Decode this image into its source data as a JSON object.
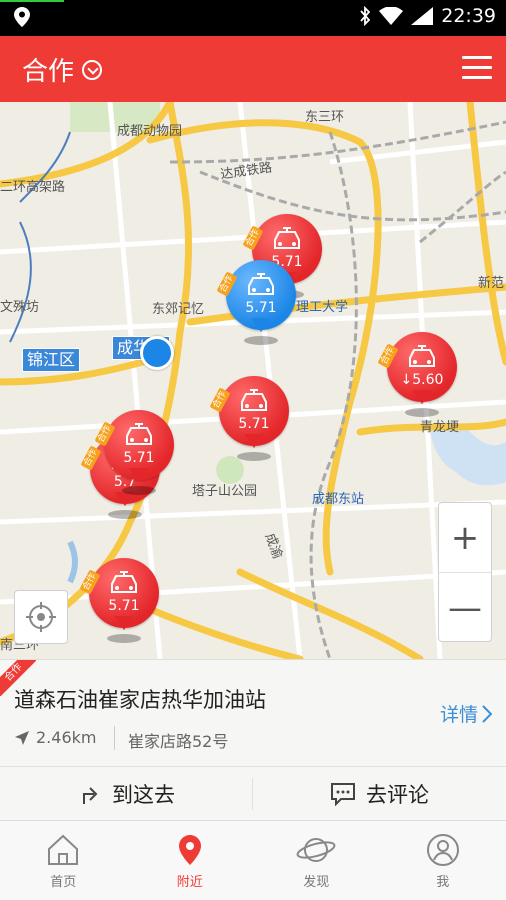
{
  "status_bar": {
    "time": "22:39"
  },
  "header": {
    "title": "合作"
  },
  "map": {
    "labels": [
      {
        "id": "zoo",
        "text": "成都动物园"
      },
      {
        "id": "dongsanhuan",
        "text": "东三环"
      },
      {
        "id": "dacheng",
        "text": "达成铁路"
      },
      {
        "id": "huangaojia",
        "text": "二环高架路"
      },
      {
        "id": "wenshufang",
        "text": "文殊坊"
      },
      {
        "id": "dongjiao",
        "text": "东郊记忆"
      },
      {
        "id": "ligong",
        "text": "理工大学"
      },
      {
        "id": "xinfan",
        "text": "新范"
      },
      {
        "id": "qinglong",
        "text": "青龙埂"
      },
      {
        "id": "tazishan",
        "text": "塔子山公园"
      },
      {
        "id": "dongzhan",
        "text": "成都东站"
      },
      {
        "id": "chengyu",
        "text": "成渝"
      },
      {
        "id": "nansan",
        "text": "南三环"
      }
    ],
    "districts": {
      "jinjiang": "锦江区",
      "chenghua": "成华区"
    },
    "pins": [
      {
        "id": "pin-top",
        "price": "5.71",
        "color": "red",
        "tag": "合作"
      },
      {
        "id": "pin-selected",
        "price": "5.71",
        "color": "blue",
        "tag": "合作"
      },
      {
        "id": "pin-right",
        "price": "↓5.60",
        "color": "red",
        "tag": "合作"
      },
      {
        "id": "pin-center",
        "price": "5.71",
        "color": "red",
        "tag": "合作"
      },
      {
        "id": "pin-left-back",
        "price": "5.7",
        "color": "red",
        "tag": "合作"
      },
      {
        "id": "pin-left-front",
        "price": "5.71",
        "color": "red",
        "tag": "合作"
      },
      {
        "id": "pin-bottom",
        "price": "5.71",
        "color": "red",
        "tag": "合作"
      }
    ],
    "zoom_in": "+",
    "zoom_out": "—"
  },
  "station": {
    "corner_tag": "合作",
    "name": "道森石油崔家店热华加油站",
    "distance": "2.46km",
    "address": "崔家店路52号",
    "detail_label": "详情",
    "go_label": "到这去",
    "comment_label": "去评论"
  },
  "tabs": [
    {
      "id": "home",
      "label": "首页"
    },
    {
      "id": "nearby",
      "label": "附近"
    },
    {
      "id": "discover",
      "label": "发现"
    },
    {
      "id": "me",
      "label": "我"
    }
  ],
  "colors": {
    "brand": "#ef3b36",
    "pin_selected": "#1c86e6",
    "link": "#3b8fd6"
  }
}
